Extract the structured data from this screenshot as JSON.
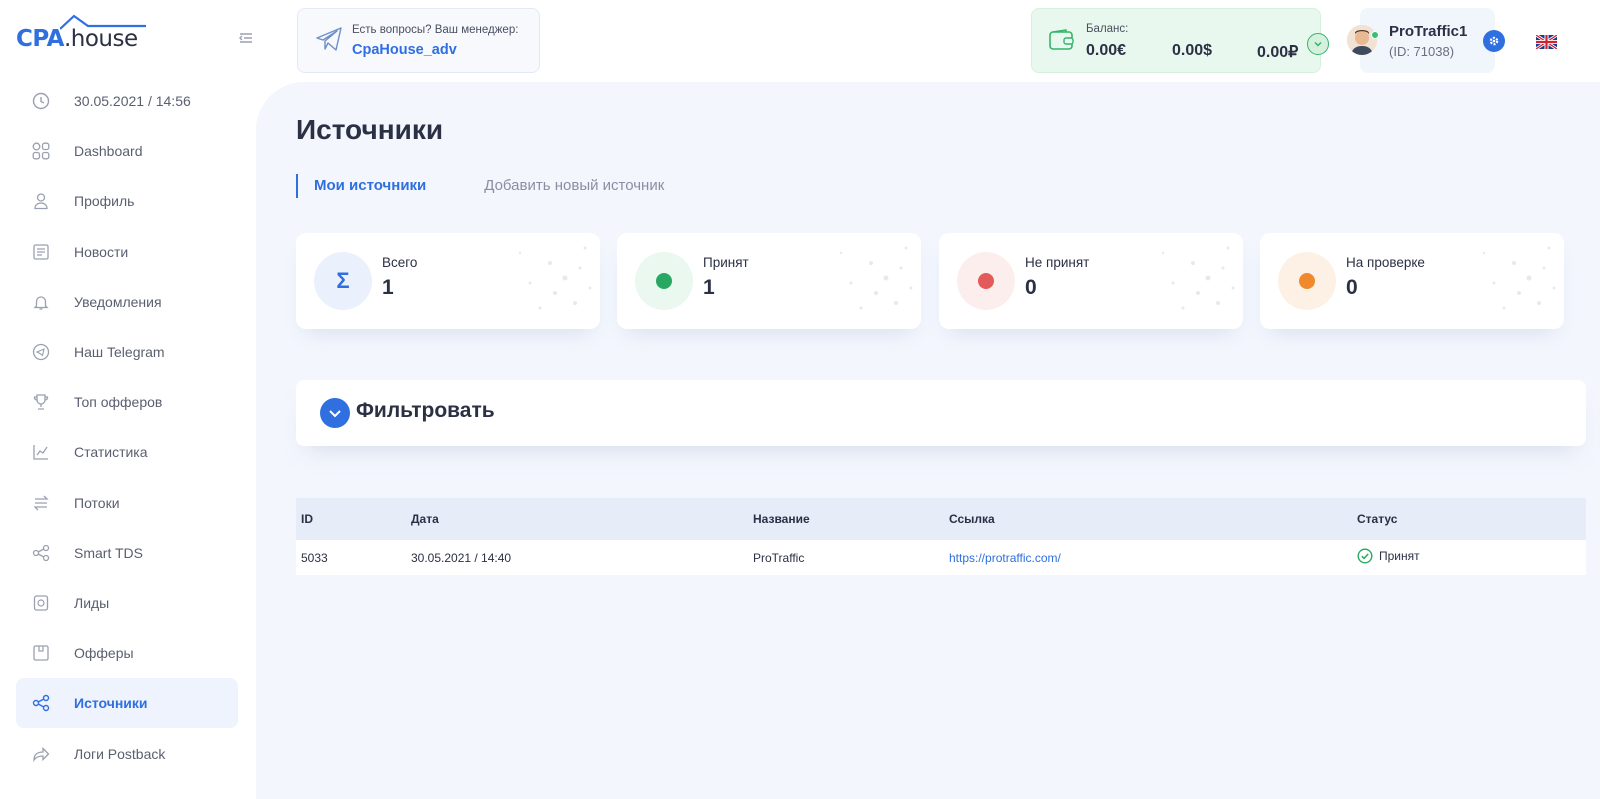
{
  "brand": {
    "logo_main": "CPA",
    "logo_suffix": ".house"
  },
  "sidebar": {
    "items": [
      {
        "label": "30.05.2021 / 14:56",
        "icon": "clock-icon"
      },
      {
        "label": "Dashboard",
        "icon": "dashboard-icon"
      },
      {
        "label": "Профиль",
        "icon": "user-icon"
      },
      {
        "label": "Новости",
        "icon": "news-icon"
      },
      {
        "label": "Уведомления",
        "icon": "bell-icon"
      },
      {
        "label": "Наш Telegram",
        "icon": "telegram-icon"
      },
      {
        "label": "Топ офферов",
        "icon": "trophy-icon"
      },
      {
        "label": "Статистика",
        "icon": "chart-icon"
      },
      {
        "label": "Потоки",
        "icon": "streams-icon"
      },
      {
        "label": "Smart TDS",
        "icon": "share-icon"
      },
      {
        "label": "Лиды",
        "icon": "leads-icon"
      },
      {
        "label": "Офферы",
        "icon": "offers-icon"
      },
      {
        "label": "Источники",
        "icon": "share-icon",
        "active": true
      },
      {
        "label": "Логи Postback",
        "icon": "forward-icon"
      }
    ]
  },
  "header": {
    "manager_question": "Есть вопросы? Ваш менеджер:",
    "manager_link": "CpaHouse_adv",
    "balance": {
      "caption": "Баланс:",
      "eur": "0.00€",
      "usd": "0.00$",
      "rub": "0.00₽"
    },
    "user": {
      "name": "ProTraffic1",
      "id": "(ID: 71038)"
    }
  },
  "page": {
    "title": "Источники",
    "tabs": [
      {
        "label": "Мои источники",
        "active": true
      },
      {
        "label": "Добавить новый источник",
        "active": false
      }
    ],
    "stats": [
      {
        "label": "Всего",
        "value": "1",
        "symbol": "Σ",
        "color": "#2f6fe0",
        "bg": "#eaf1fd"
      },
      {
        "label": "Принят",
        "value": "1",
        "color": "#27a862",
        "bg": "#eaf8ef"
      },
      {
        "label": "Не принят",
        "value": "0",
        "color": "#e35a5a",
        "bg": "#fdeeee"
      },
      {
        "label": "На проверке",
        "value": "0",
        "color": "#f0892b",
        "bg": "#fdf1e6"
      }
    ],
    "filter_title": "Фильтровать",
    "table": {
      "headers": [
        "ID",
        "Дата",
        "Название",
        "Ссылка",
        "Статус"
      ],
      "rows": [
        {
          "id": "5033",
          "date": "30.05.2021 / 14:40",
          "name": "ProTraffic",
          "link": "https://protraffic.com/",
          "status": "Принят"
        }
      ]
    }
  }
}
